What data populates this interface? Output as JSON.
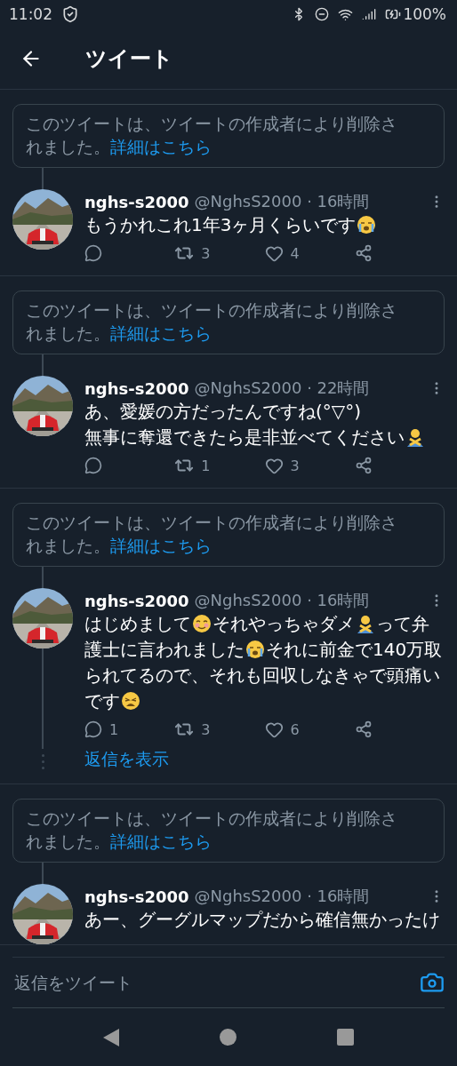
{
  "status_bar": {
    "time": "11:02",
    "battery": "100%"
  },
  "header": {
    "title": "ツイート"
  },
  "threads": [
    {
      "deleted_notice": {
        "text": "このツイートは、ツイートの作成者により削除されました。",
        "link": "詳細はこちら"
      },
      "tweet": {
        "name": "nghs-s2000",
        "handle": "@NghsS2000 · 16時間",
        "body": [
          {
            "kind": "text",
            "text": "もうかれこれ1年3ヶ月くらいです"
          },
          {
            "kind": "crying"
          }
        ],
        "retweets": "3",
        "likes": "4"
      }
    },
    {
      "deleted_notice": {
        "text": "このツイートは、ツイートの作成者により削除されました。",
        "link": "詳細はこちら"
      },
      "tweet": {
        "name": "nghs-s2000",
        "handle": "@NghsS2000 · 22時間",
        "body": [
          {
            "kind": "text",
            "text": "あ、愛媛の方だったんですね(°▽°)\n無事に奪還できたら是非並べてください"
          },
          {
            "kind": "gesture"
          }
        ],
        "retweets": "1",
        "likes": "3"
      }
    },
    {
      "deleted_notice": {
        "text": "このツイートは、ツイートの作成者により削除されました。",
        "link": "詳細はこちら"
      },
      "tweet": {
        "name": "nghs-s2000",
        "handle": "@NghsS2000 · 16時間",
        "body": [
          {
            "kind": "text",
            "text": "はじめまして"
          },
          {
            "kind": "smiling"
          },
          {
            "kind": "text",
            "text": "それやっちゃダメ"
          },
          {
            "kind": "gesture"
          },
          {
            "kind": "text",
            "text": "って弁護士に言われました"
          },
          {
            "kind": "crying"
          },
          {
            "kind": "text",
            "text": "それに前金で140万取られてるので、それも回収しなきゃで頭痛いです"
          },
          {
            "kind": "weary"
          }
        ],
        "replies": "1",
        "retweets": "3",
        "likes": "6",
        "show_replies": "返信を表示"
      }
    },
    {
      "deleted_notice": {
        "text": "このツイートは、ツイートの作成者により削除されました。",
        "link": "詳細はこちら"
      },
      "tweet": {
        "name": "nghs-s2000",
        "handle": "@NghsS2000 · 16時間",
        "body": [
          {
            "kind": "text",
            "text": "あー、グーグルマップだから確信無かったけ"
          }
        ]
      }
    }
  ],
  "reply_bar": {
    "placeholder": "返信をツイート"
  }
}
